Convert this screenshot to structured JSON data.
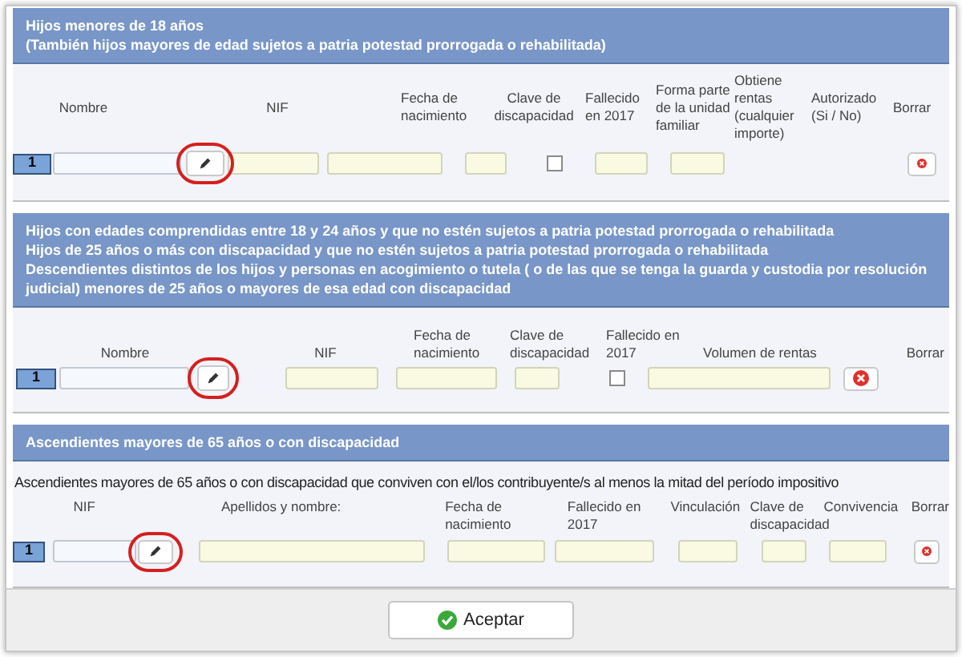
{
  "sections": [
    {
      "title_lines": [
        "Hijos menores de 18 años",
        "(También hijos mayores de edad sujetos a patria potestad prorrogada o rehabilitada)"
      ],
      "headings": [
        "Nombre",
        "NIF",
        "Fecha de nacimiento",
        "Clave de discapacidad",
        "Fallecido en 2017",
        "Forma parte de la unidad familiar",
        "Obtiene rentas (cualquier importe)",
        "Autorizado (Si / No)",
        "Borrar"
      ],
      "row": {
        "number": "1",
        "controls": [
          {
            "kind": "name"
          },
          {
            "kind": "field"
          },
          {
            "kind": "field"
          },
          {
            "kind": "field"
          },
          {
            "kind": "checkbox",
            "checked": false
          },
          {
            "kind": "field"
          },
          {
            "kind": "field"
          },
          {
            "kind": "delete"
          }
        ]
      }
    },
    {
      "title_lines": [
        "Hijos con edades comprendidas entre 18 y 24 años y que no estén sujetos a patria potestad prorrogada o rehabilitada",
        "Hijos de 25 años o más con discapacidad y que no estén sujetos a patria potestad prorrogada o rehabilitada",
        "Descendientes distintos de los hijos y personas en acogimiento o tutela ( o de las que se tenga la guarda y custodia por resolución judicial) menores de 25 años o mayores de esa edad con discapacidad"
      ],
      "headings": [
        "Nombre",
        "NIF",
        "Fecha de nacimiento",
        "Clave de discapacidad",
        "Fallecido en 2017",
        "Volumen de rentas",
        "Borrar"
      ],
      "row": {
        "number": "1",
        "controls": [
          {
            "kind": "name"
          },
          {
            "kind": "field"
          },
          {
            "kind": "field"
          },
          {
            "kind": "field"
          },
          {
            "kind": "checkbox",
            "checked": false
          },
          {
            "kind": "field"
          },
          {
            "kind": "delete"
          }
        ]
      }
    },
    {
      "title_lines": [
        "Ascendientes mayores de 65 años o con discapacidad"
      ],
      "subtitle": "Ascendientes mayores de 65 años o con discapacidad que conviven con el/los contribuyente/s al menos la mitad del período impositivo",
      "headings": [
        "NIF",
        "Apellidos y nombre:",
        "Fecha de nacimiento",
        "Fallecido en 2017",
        "Vinculación",
        "Clave de discapacidad",
        "Convivencia",
        "Borrar"
      ],
      "row": {
        "number": "1",
        "controls": [
          {
            "kind": "name"
          },
          {
            "kind": "field"
          },
          {
            "kind": "field"
          },
          {
            "kind": "field"
          },
          {
            "kind": "field"
          },
          {
            "kind": "field"
          },
          {
            "kind": "field"
          },
          {
            "kind": "delete"
          }
        ]
      }
    }
  ],
  "footer": {
    "button": "Aceptar"
  }
}
